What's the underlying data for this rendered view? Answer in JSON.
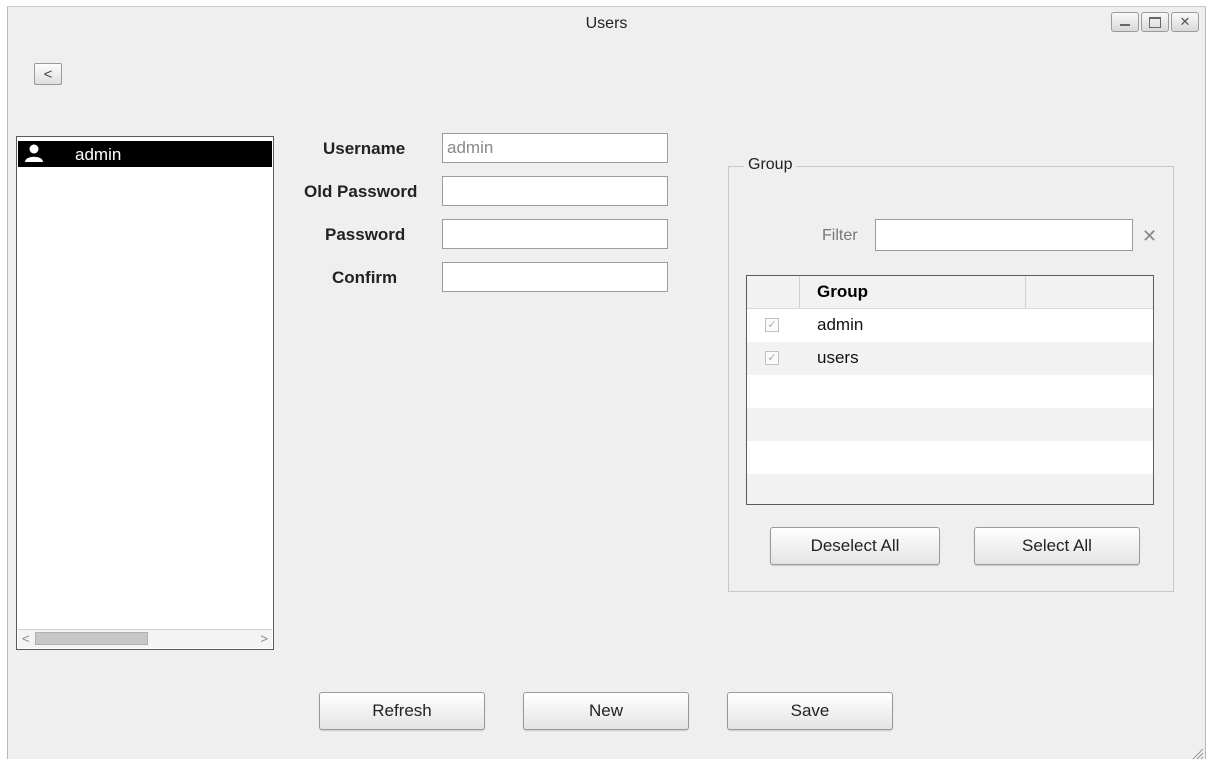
{
  "window": {
    "title": "Users",
    "back_label": "<"
  },
  "users": {
    "items": [
      {
        "label": "admin",
        "icon": "user-icon",
        "selected": true
      }
    ],
    "scroll_left": "<",
    "scroll_right": ">"
  },
  "form": {
    "username_label": "Username",
    "username_value": "admin",
    "old_password_label": "Old Password",
    "old_password_value": "",
    "password_label": "Password",
    "password_value": "",
    "confirm_label": "Confirm",
    "confirm_value": ""
  },
  "group": {
    "legend": "Group",
    "filter_label": "Filter",
    "filter_value": "",
    "clear_icon": "close-icon",
    "clear_glyph": "✕",
    "column_header": "Group",
    "rows": [
      {
        "name": "admin",
        "checked": true
      },
      {
        "name": "users",
        "checked": true
      }
    ],
    "deselect_all_label": "Deselect All",
    "select_all_label": "Select All"
  },
  "actions": {
    "refresh_label": "Refresh",
    "new_label": "New",
    "save_label": "Save"
  },
  "colors": {
    "window_bg": "#efefef",
    "selection_bg": "#000000",
    "selection_fg": "#ffffff"
  }
}
